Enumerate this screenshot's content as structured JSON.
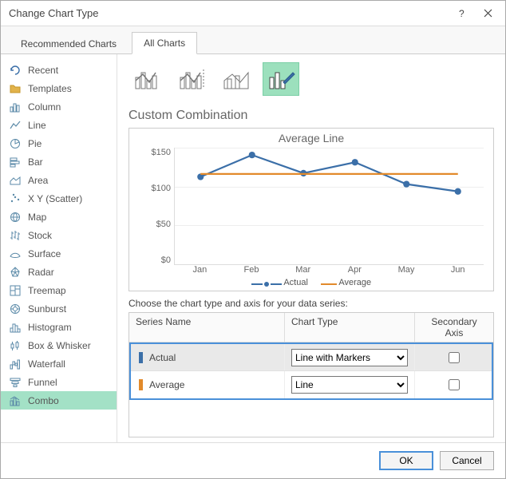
{
  "window": {
    "title": "Change Chart Type"
  },
  "tabs": {
    "recommended": "Recommended Charts",
    "all": "All Charts"
  },
  "sidebar": {
    "items": [
      {
        "label": "Recent"
      },
      {
        "label": "Templates"
      },
      {
        "label": "Column"
      },
      {
        "label": "Line"
      },
      {
        "label": "Pie"
      },
      {
        "label": "Bar"
      },
      {
        "label": "Area"
      },
      {
        "label": "X Y (Scatter)"
      },
      {
        "label": "Map"
      },
      {
        "label": "Stock"
      },
      {
        "label": "Surface"
      },
      {
        "label": "Radar"
      },
      {
        "label": "Treemap"
      },
      {
        "label": "Sunburst"
      },
      {
        "label": "Histogram"
      },
      {
        "label": "Box & Whisker"
      },
      {
        "label": "Waterfall"
      },
      {
        "label": "Funnel"
      },
      {
        "label": "Combo"
      }
    ]
  },
  "section": {
    "title": "Custom Combination"
  },
  "chart": {
    "title": "Average Line",
    "yticks": [
      "$150",
      "$100",
      "$50",
      "$0"
    ],
    "xticks": [
      "Jan",
      "Feb",
      "Mar",
      "Apr",
      "May",
      "Jun"
    ],
    "legend": {
      "actual": "Actual",
      "average": "Average"
    }
  },
  "series_config": {
    "label": "Choose the chart type and axis for your data series:",
    "headers": {
      "name": "Series Name",
      "type": "Chart Type",
      "axis": "Secondary Axis"
    },
    "rows": [
      {
        "name": "Actual",
        "color": "#3b6fa8",
        "type": "Line with Markers",
        "secondary": false
      },
      {
        "name": "Average",
        "color": "#e28a2b",
        "type": "Line",
        "secondary": false
      }
    ]
  },
  "buttons": {
    "ok": "OK",
    "cancel": "Cancel"
  },
  "chart_data": {
    "type": "line",
    "title": "Average Line",
    "xlabel": "",
    "ylabel": "",
    "ylim": [
      0,
      160
    ],
    "categories": [
      "Jan",
      "Feb",
      "Mar",
      "Apr",
      "May",
      "Jun"
    ],
    "series": [
      {
        "name": "Actual",
        "values": [
          120,
          150,
          125,
          140,
          110,
          100
        ],
        "marker": true,
        "color": "#3b6fa8"
      },
      {
        "name": "Average",
        "values": [
          124,
          124,
          124,
          124,
          124,
          124
        ],
        "marker": false,
        "color": "#e28a2b"
      }
    ]
  }
}
